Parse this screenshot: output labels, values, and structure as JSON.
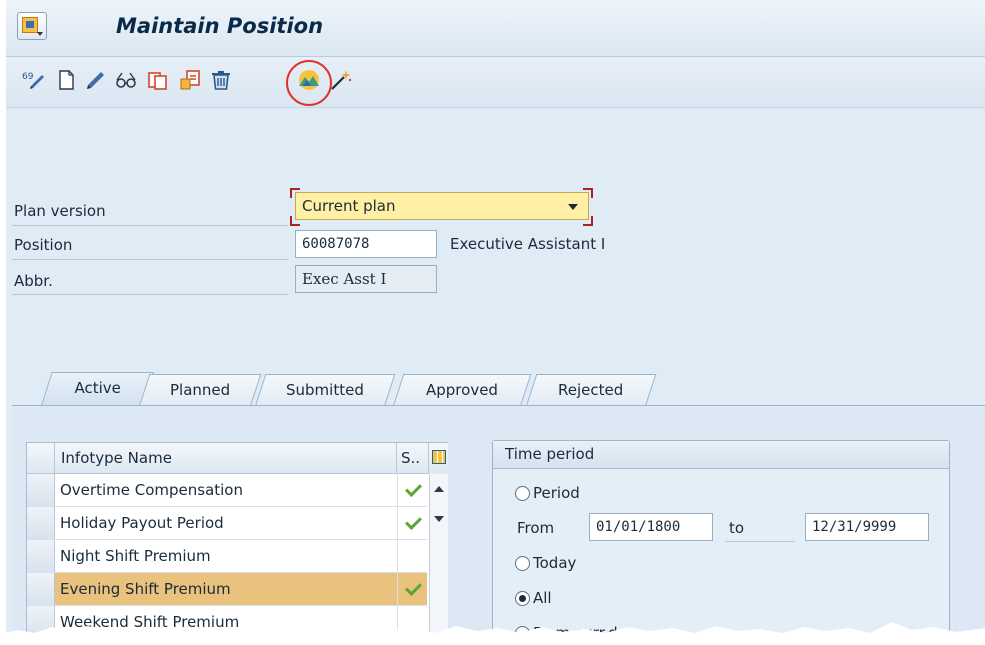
{
  "window": {
    "title": "Maintain Position"
  },
  "toolbar": {
    "buttons": [
      {
        "name": "change-icon"
      },
      {
        "name": "create-icon"
      },
      {
        "name": "edit-icon"
      },
      {
        "name": "display-icon"
      },
      {
        "name": "copy-icon"
      },
      {
        "name": "delimit-icon"
      },
      {
        "name": "delete-icon"
      },
      {
        "name": "org-overview-icon",
        "highlighted": true
      },
      {
        "name": "wizard-icon"
      }
    ],
    "highlight_color": "#e2302a"
  },
  "header": {
    "plan_version": {
      "label": "Plan version",
      "value": "Current plan"
    },
    "position": {
      "label": "Position",
      "value": "60087078",
      "description": "Executive Assistant I"
    },
    "abbr": {
      "label": "Abbr.",
      "value": "Exec Asst I"
    }
  },
  "tabs": [
    {
      "label": "Active",
      "active": true
    },
    {
      "label": "Planned"
    },
    {
      "label": "Submitted"
    },
    {
      "label": "Approved"
    },
    {
      "label": "Rejected"
    }
  ],
  "infotype_table": {
    "columns": {
      "name": "Infotype Name",
      "status": "S.."
    },
    "rows": [
      {
        "name": "Overtime Compensation",
        "status": "check"
      },
      {
        "name": "Holiday Payout Period",
        "status": "check"
      },
      {
        "name": "Night Shift Premium",
        "status": ""
      },
      {
        "name": "Evening Shift Premium",
        "status": "check",
        "selected": true
      },
      {
        "name": "Weekend Shift Premium",
        "status": ""
      }
    ],
    "selected_row_color": "#e9c27d"
  },
  "time_period": {
    "title": "Time period",
    "period_label": "Period",
    "from_label": "From",
    "from_value": "01/01/1800",
    "to_label": "to",
    "to_value": "12/31/9999",
    "today_label": "Today",
    "all_label": "All",
    "from_curr_label": "From curr.date",
    "selected": "All"
  }
}
